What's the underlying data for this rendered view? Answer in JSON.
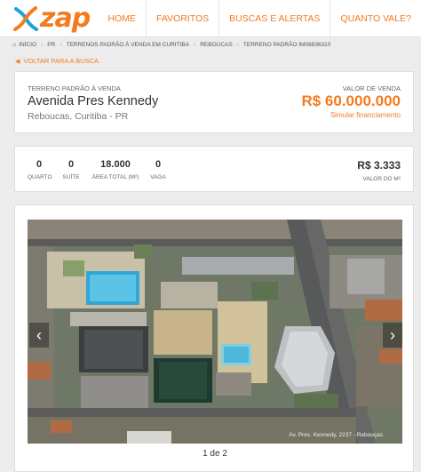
{
  "brand": {
    "logo_text": "zap",
    "accent_color": "#f47b20"
  },
  "nav": [
    {
      "label": "HOME"
    },
    {
      "label": "FAVORITOS"
    },
    {
      "label": "BUSCAS E ALERTAS"
    },
    {
      "label": "QUANTO VALE?"
    }
  ],
  "breadcrumb": {
    "home_icon": "home-icon",
    "items": [
      "INÍCIO",
      "PR",
      "TERRENOS PADRÃO À VENDA EM CURITIBA",
      "REBOUCAS",
      "TERRENO PADRÃO IM08836310"
    ]
  },
  "back_link": "VOLTAR PARA A BUSCA",
  "listing": {
    "type": "TERRENO PADRÃO À VENDA",
    "name": "Avenida Pres Kennedy",
    "location": "Reboucas, Curitiba - PR",
    "price_label": "VALOR DE VENDA",
    "price": "R$ 60.000.000",
    "finance_link": "Simular financiamento"
  },
  "stats": [
    {
      "value": "0",
      "label": "QUARTO"
    },
    {
      "value": "0",
      "label": "SUÍTE"
    },
    {
      "value": "18.000",
      "label": "ÁREA TOTAL (M²)"
    },
    {
      "value": "0",
      "label": "VAGA"
    }
  ],
  "price_per_m2": {
    "value": "R$ 3.333",
    "label": "VALOR DO M²"
  },
  "gallery": {
    "prev_icon": "‹",
    "next_icon": "›",
    "watermark": "Av. Pres. Kennedy, 2237 - Rebouças",
    "counter": "1 de 2"
  }
}
